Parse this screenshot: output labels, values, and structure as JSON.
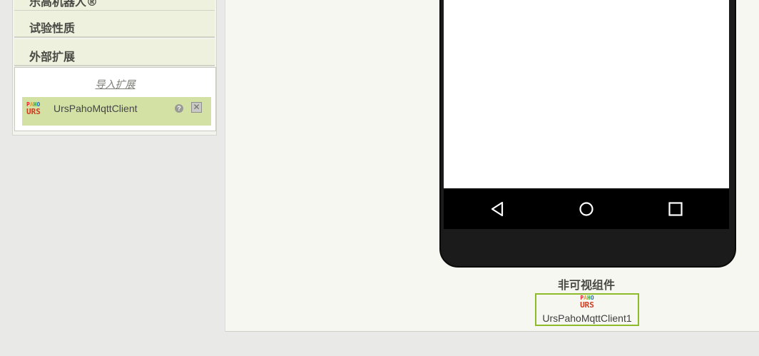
{
  "palette": {
    "categories": [
      {
        "label": "乐高机器人®"
      },
      {
        "label": "试验性质"
      },
      {
        "label": "外部扩展"
      }
    ],
    "extensions_panel": {
      "import_label": "导入扩展",
      "items": [
        {
          "name": "UrsPahoMqttClient",
          "logo_top": [
            "P",
            "A",
            "H",
            "O"
          ],
          "logo_bottom": "URS",
          "help": "?",
          "delete": "✕"
        }
      ]
    }
  },
  "viewer": {
    "nav_buttons": [
      "back-icon",
      "home-icon",
      "recent-apps-icon"
    ],
    "nonvisible_label": "非可视组件",
    "nonvisible_components": [
      {
        "name": "UrsPahoMqttClient1",
        "logo_top": [
          "P",
          "A",
          "H",
          "O"
        ],
        "logo_bottom": "URS"
      }
    ]
  },
  "colors": {
    "category_bg": "#edf1de",
    "extension_item_bg": "#d3e1a5",
    "selected_border": "#8dbb2a",
    "nav_bar": "#000000"
  }
}
